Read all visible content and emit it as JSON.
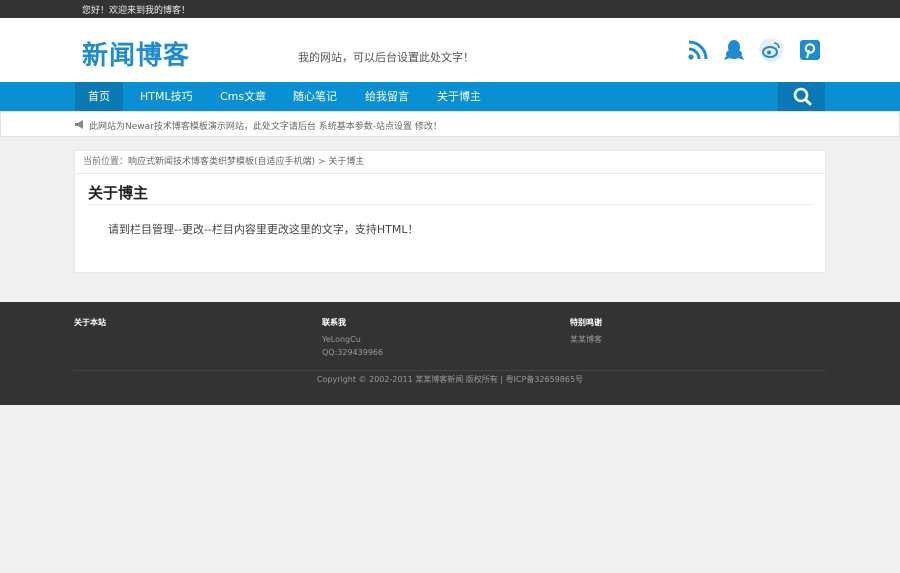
{
  "topbar": {
    "greeting": "您好！欢迎来到我的博客！"
  },
  "header": {
    "logo": "新闻博客",
    "slogan": "我的网站，可以后台设置此处文字！",
    "social_icons": [
      "rss-icon",
      "qq-icon",
      "weibo-icon",
      "pinterest-icon"
    ]
  },
  "nav": {
    "items": [
      {
        "label": "首页",
        "active": true
      },
      {
        "label": "HTML技巧"
      },
      {
        "label": "Cms文章"
      },
      {
        "label": "随心笔记"
      },
      {
        "label": "给我留言"
      },
      {
        "label": "关于博主"
      }
    ],
    "search_icon": "search-icon"
  },
  "notice": {
    "text": "此网站为Newar技术博客模板演示网站，此处文字请后台 系统基本参数-站点设置 修改！"
  },
  "breadcrumb": {
    "prefix": "当前位置：",
    "home": "响应式新闻技术博客类织梦模板(自适应手机端)",
    "separator": " > ",
    "current": "关于博主"
  },
  "content": {
    "title": "关于博主",
    "body": "请到栏目管理--更改--栏目内容里更改这里的文字，支持HTML！"
  },
  "footer": {
    "columns": [
      {
        "title": "关于本站",
        "lines": []
      },
      {
        "title": "联系我",
        "lines": [
          "YeLongCu",
          "QQ:329439966"
        ]
      },
      {
        "title": "特别鸣谢",
        "lines": [
          "某某博客"
        ]
      }
    ],
    "copyright": "Copyright © 2002-2011 某某博客新闻 版权所有 | 粤ICP备32659865号"
  },
  "colors": {
    "accent": "#0a8fd3",
    "nav_active": "#0a79b5",
    "dark": "#333333"
  }
}
